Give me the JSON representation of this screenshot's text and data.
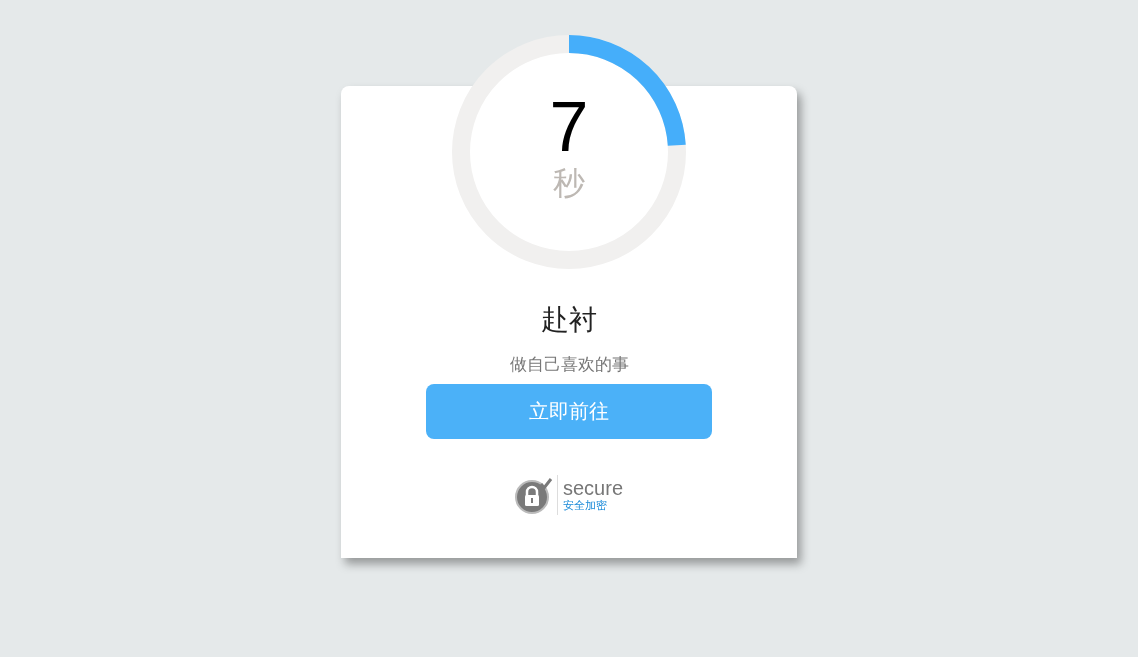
{
  "countdown": {
    "number": "7",
    "unit": "秒"
  },
  "title": "赴衬",
  "subtitle": "做自己喜欢的事",
  "button": {
    "label": "立即前往"
  },
  "secure_badge": {
    "title": "secure",
    "caption": "安全加密"
  }
}
